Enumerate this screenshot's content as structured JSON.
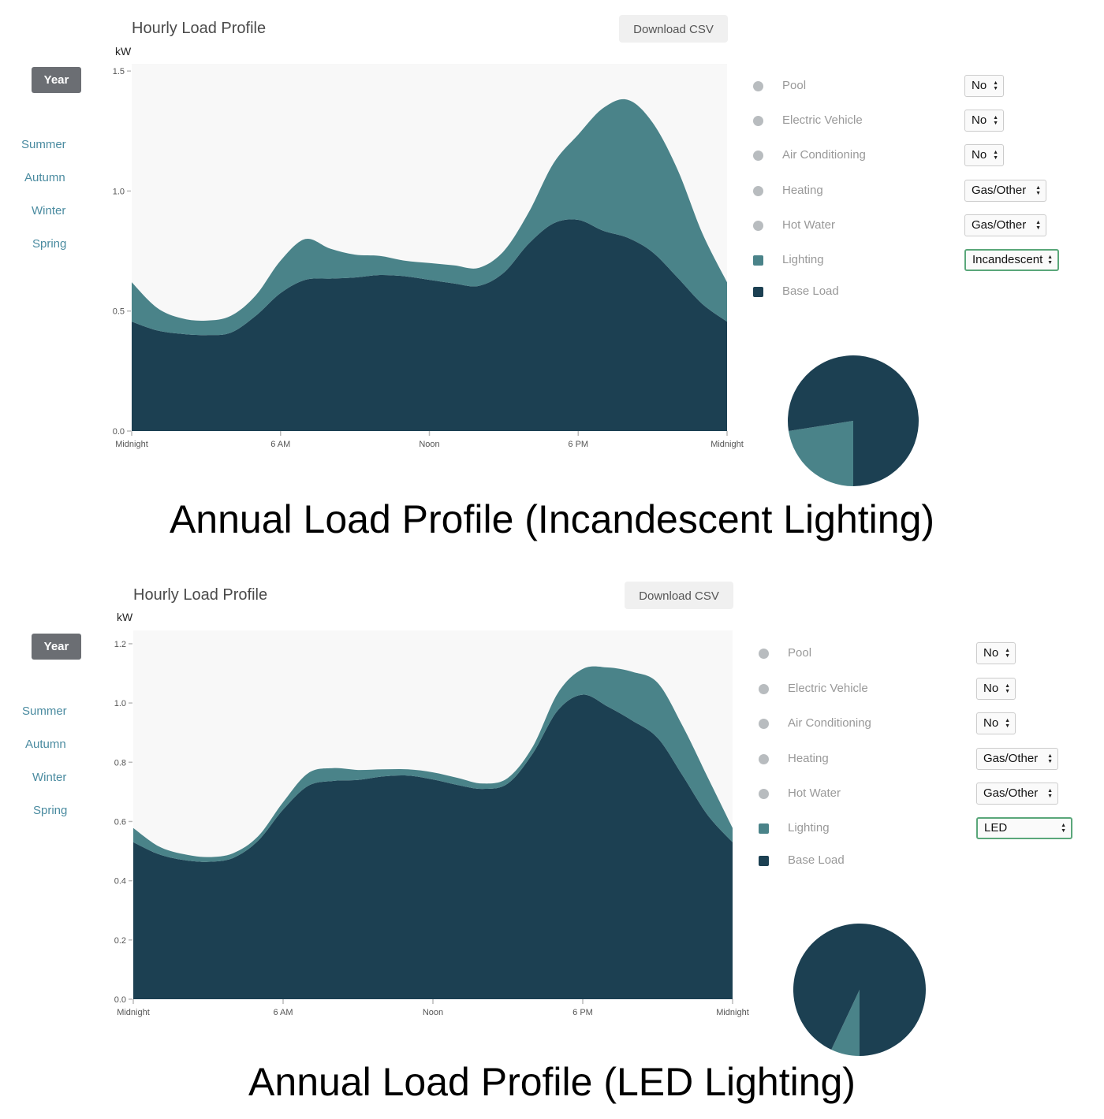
{
  "colors": {
    "base_load": "#1c4052",
    "lighting": "#4a8389",
    "plot_bg": "#f8f8f8",
    "inactive_legend": "#b8bcbf",
    "season_link": "#4a8ba0",
    "active_season_bg": "#6b6e73",
    "focused_select_border": "#5aa77a"
  },
  "panels": [
    {
      "caption": "Annual Load Profile (Incandescent Lighting)",
      "title": "Hourly Load Profile",
      "download_label": "Download CSV",
      "y_unit": "kW",
      "seasons": [
        {
          "label": "Year",
          "active": true
        },
        {
          "label": "Summer",
          "active": false
        },
        {
          "label": "Autumn",
          "active": false
        },
        {
          "label": "Winter",
          "active": false
        },
        {
          "label": "Spring",
          "active": false
        }
      ],
      "legend": [
        {
          "label": "Pool",
          "swatch": "circle",
          "value": "No"
        },
        {
          "label": "Electric Vehicle",
          "swatch": "circle",
          "value": "No"
        },
        {
          "label": "Air Conditioning",
          "swatch": "circle",
          "value": "No"
        },
        {
          "label": "Heating",
          "swatch": "circle",
          "value": "Gas/Other"
        },
        {
          "label": "Hot Water",
          "swatch": "circle",
          "value": "Gas/Other"
        },
        {
          "label": "Lighting",
          "swatch": "lighting",
          "value": "Incandescent",
          "focused": true
        },
        {
          "label": "Base Load",
          "swatch": "base_load",
          "value": null
        }
      ]
    },
    {
      "caption": "Annual Load Profile (LED Lighting)",
      "title": "Hourly Load Profile",
      "download_label": "Download CSV",
      "y_unit": "kW",
      "seasons": [
        {
          "label": "Year",
          "active": true
        },
        {
          "label": "Summer",
          "active": false
        },
        {
          "label": "Autumn",
          "active": false
        },
        {
          "label": "Winter",
          "active": false
        },
        {
          "label": "Spring",
          "active": false
        }
      ],
      "legend": [
        {
          "label": "Pool",
          "swatch": "circle",
          "value": "No"
        },
        {
          "label": "Electric Vehicle",
          "swatch": "circle",
          "value": "No"
        },
        {
          "label": "Air Conditioning",
          "swatch": "circle",
          "value": "No"
        },
        {
          "label": "Heating",
          "swatch": "circle",
          "value": "Gas/Other"
        },
        {
          "label": "Hot Water",
          "swatch": "circle",
          "value": "Gas/Other"
        },
        {
          "label": "Lighting",
          "swatch": "lighting",
          "value": "LED",
          "focused": true
        },
        {
          "label": "Base Load",
          "swatch": "base_load",
          "value": null
        }
      ]
    }
  ],
  "chart_data": [
    {
      "type": "area",
      "stacked": true,
      "title": "Hourly Load Profile",
      "subtitle": "Annual Load Profile (Incandescent Lighting)",
      "xlabel": "",
      "ylabel": "kW",
      "x": [
        0,
        1,
        2,
        3,
        4,
        5,
        6,
        7,
        8,
        9,
        10,
        11,
        12,
        13,
        14,
        15,
        16,
        17,
        18,
        19,
        20,
        21,
        22,
        23,
        24
      ],
      "x_ticks": [
        {
          "value": 0,
          "label": "Midnight"
        },
        {
          "value": 6,
          "label": "6 AM"
        },
        {
          "value": 12,
          "label": "Noon"
        },
        {
          "value": 18,
          "label": "6 PM"
        },
        {
          "value": 24,
          "label": "Midnight"
        }
      ],
      "y_ticks": [
        "0.0",
        "0.5",
        "1.0",
        "1.5"
      ],
      "y_tick_values": [
        0,
        0.5,
        1.0,
        1.5
      ],
      "xlim": [
        0,
        24
      ],
      "ylim": [
        0,
        1.53
      ],
      "grid": false,
      "legend_position": "right",
      "series": [
        {
          "name": "Base Load",
          "color_key": "base_load",
          "values": [
            0.456,
            0.42,
            0.405,
            0.4,
            0.41,
            0.48,
            0.575,
            0.63,
            0.635,
            0.64,
            0.65,
            0.645,
            0.63,
            0.615,
            0.605,
            0.66,
            0.78,
            0.865,
            0.88,
            0.835,
            0.805,
            0.745,
            0.64,
            0.53,
            0.456
          ]
        },
        {
          "name": "Lighting",
          "color_key": "lighting",
          "values": [
            0.164,
            0.095,
            0.065,
            0.06,
            0.07,
            0.085,
            0.135,
            0.17,
            0.125,
            0.095,
            0.08,
            0.065,
            0.07,
            0.075,
            0.075,
            0.09,
            0.13,
            0.25,
            0.355,
            0.51,
            0.575,
            0.54,
            0.45,
            0.295,
            0.164
          ]
        }
      ],
      "pie": {
        "slices": [
          {
            "name": "Base Load",
            "color_key": "base_load",
            "fraction": 0.775
          },
          {
            "name": "Lighting",
            "color_key": "lighting",
            "fraction": 0.225
          }
        ]
      }
    },
    {
      "type": "area",
      "stacked": true,
      "title": "Hourly Load Profile",
      "subtitle": "Annual Load Profile (LED Lighting)",
      "xlabel": "",
      "ylabel": "kW",
      "x": [
        0,
        1,
        2,
        3,
        4,
        5,
        6,
        7,
        8,
        9,
        10,
        11,
        12,
        13,
        14,
        15,
        16,
        17,
        18,
        19,
        20,
        21,
        22,
        23,
        24
      ],
      "x_ticks": [
        {
          "value": 0,
          "label": "Midnight"
        },
        {
          "value": 6,
          "label": "6 AM"
        },
        {
          "value": 12,
          "label": "Noon"
        },
        {
          "value": 18,
          "label": "6 PM"
        },
        {
          "value": 24,
          "label": "Midnight"
        }
      ],
      "y_ticks": [
        "0.0",
        "0.2",
        "0.4",
        "0.6",
        "0.8",
        "1.0",
        "1.2"
      ],
      "y_tick_values": [
        0,
        0.2,
        0.4,
        0.6,
        0.8,
        1.0,
        1.2
      ],
      "xlim": [
        0,
        24
      ],
      "ylim": [
        0,
        1.245
      ],
      "grid": false,
      "legend_position": "right",
      "series": [
        {
          "name": "Base Load",
          "color_key": "base_load",
          "values": [
            0.53,
            0.49,
            0.47,
            0.464,
            0.477,
            0.535,
            0.64,
            0.72,
            0.737,
            0.74,
            0.752,
            0.755,
            0.742,
            0.723,
            0.71,
            0.728,
            0.83,
            0.975,
            1.028,
            0.988,
            0.94,
            0.882,
            0.755,
            0.622,
            0.53
          ]
        },
        {
          "name": "Lighting",
          "color_key": "lighting",
          "values": [
            0.048,
            0.027,
            0.02,
            0.016,
            0.016,
            0.015,
            0.025,
            0.043,
            0.043,
            0.034,
            0.024,
            0.021,
            0.024,
            0.024,
            0.018,
            0.019,
            0.023,
            0.058,
            0.087,
            0.132,
            0.165,
            0.186,
            0.167,
            0.128,
            0.048
          ]
        }
      ],
      "pie": {
        "slices": [
          {
            "name": "Base Load",
            "color_key": "base_load",
            "fraction": 0.93
          },
          {
            "name": "Lighting",
            "color_key": "lighting",
            "fraction": 0.07
          }
        ]
      }
    }
  ]
}
